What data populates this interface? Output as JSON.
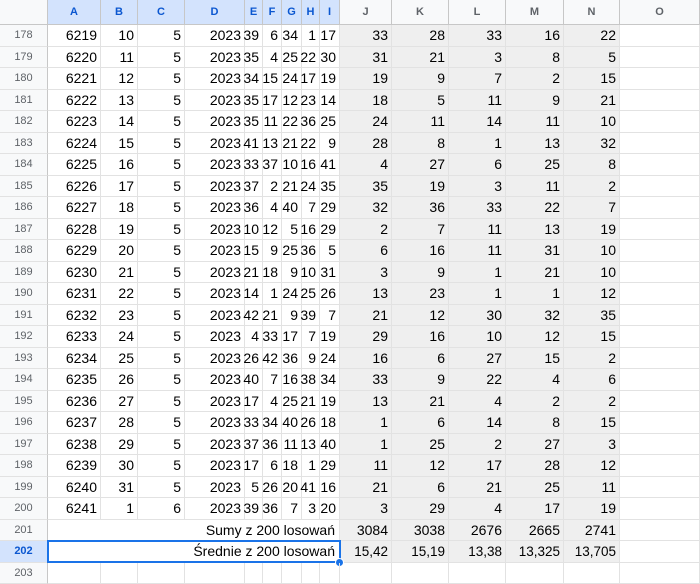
{
  "columns": [
    "A",
    "B",
    "C",
    "D",
    "E",
    "F",
    "G",
    "H",
    "I",
    "J",
    "K",
    "L",
    "M",
    "N",
    "O"
  ],
  "selected_row": "202",
  "rows": [
    {
      "num": "178",
      "cells": [
        "6219",
        "10",
        "5",
        "2023",
        "39",
        "6",
        "34",
        "1",
        "17",
        "33",
        "28",
        "33",
        "16",
        "22"
      ]
    },
    {
      "num": "179",
      "cells": [
        "6220",
        "11",
        "5",
        "2023",
        "35",
        "4",
        "25",
        "22",
        "30",
        "31",
        "21",
        "3",
        "8",
        "5"
      ]
    },
    {
      "num": "180",
      "cells": [
        "6221",
        "12",
        "5",
        "2023",
        "34",
        "15",
        "24",
        "17",
        "19",
        "19",
        "9",
        "7",
        "2",
        "15"
      ]
    },
    {
      "num": "181",
      "cells": [
        "6222",
        "13",
        "5",
        "2023",
        "35",
        "17",
        "12",
        "23",
        "14",
        "18",
        "5",
        "11",
        "9",
        "21"
      ]
    },
    {
      "num": "182",
      "cells": [
        "6223",
        "14",
        "5",
        "2023",
        "35",
        "11",
        "22",
        "36",
        "25",
        "24",
        "11",
        "14",
        "11",
        "10"
      ]
    },
    {
      "num": "183",
      "cells": [
        "6224",
        "15",
        "5",
        "2023",
        "41",
        "13",
        "21",
        "22",
        "9",
        "28",
        "8",
        "1",
        "13",
        "32"
      ]
    },
    {
      "num": "184",
      "cells": [
        "6225",
        "16",
        "5",
        "2023",
        "33",
        "37",
        "10",
        "16",
        "41",
        "4",
        "27",
        "6",
        "25",
        "8"
      ]
    },
    {
      "num": "185",
      "cells": [
        "6226",
        "17",
        "5",
        "2023",
        "37",
        "2",
        "21",
        "24",
        "35",
        "35",
        "19",
        "3",
        "11",
        "2"
      ]
    },
    {
      "num": "186",
      "cells": [
        "6227",
        "18",
        "5",
        "2023",
        "36",
        "4",
        "40",
        "7",
        "29",
        "32",
        "36",
        "33",
        "22",
        "7"
      ]
    },
    {
      "num": "187",
      "cells": [
        "6228",
        "19",
        "5",
        "2023",
        "10",
        "12",
        "5",
        "16",
        "29",
        "2",
        "7",
        "11",
        "13",
        "19"
      ]
    },
    {
      "num": "188",
      "cells": [
        "6229",
        "20",
        "5",
        "2023",
        "15",
        "9",
        "25",
        "36",
        "5",
        "6",
        "16",
        "11",
        "31",
        "10"
      ]
    },
    {
      "num": "189",
      "cells": [
        "6230",
        "21",
        "5",
        "2023",
        "21",
        "18",
        "9",
        "10",
        "31",
        "3",
        "9",
        "1",
        "21",
        "10"
      ]
    },
    {
      "num": "190",
      "cells": [
        "6231",
        "22",
        "5",
        "2023",
        "14",
        "1",
        "24",
        "25",
        "26",
        "13",
        "23",
        "1",
        "1",
        "12"
      ]
    },
    {
      "num": "191",
      "cells": [
        "6232",
        "23",
        "5",
        "2023",
        "42",
        "21",
        "9",
        "39",
        "7",
        "21",
        "12",
        "30",
        "32",
        "35"
      ]
    },
    {
      "num": "192",
      "cells": [
        "6233",
        "24",
        "5",
        "2023",
        "4",
        "33",
        "17",
        "7",
        "19",
        "29",
        "16",
        "10",
        "12",
        "15"
      ]
    },
    {
      "num": "193",
      "cells": [
        "6234",
        "25",
        "5",
        "2023",
        "26",
        "42",
        "36",
        "9",
        "24",
        "16",
        "6",
        "27",
        "15",
        "2"
      ]
    },
    {
      "num": "194",
      "cells": [
        "6235",
        "26",
        "5",
        "2023",
        "40",
        "7",
        "16",
        "38",
        "34",
        "33",
        "9",
        "22",
        "4",
        "6"
      ]
    },
    {
      "num": "195",
      "cells": [
        "6236",
        "27",
        "5",
        "2023",
        "17",
        "4",
        "25",
        "21",
        "19",
        "13",
        "21",
        "4",
        "2",
        "2"
      ]
    },
    {
      "num": "196",
      "cells": [
        "6237",
        "28",
        "5",
        "2023",
        "33",
        "34",
        "40",
        "26",
        "18",
        "1",
        "6",
        "14",
        "8",
        "15"
      ]
    },
    {
      "num": "197",
      "cells": [
        "6238",
        "29",
        "5",
        "2023",
        "37",
        "36",
        "11",
        "13",
        "40",
        "1",
        "25",
        "2",
        "27",
        "3"
      ]
    },
    {
      "num": "198",
      "cells": [
        "6239",
        "30",
        "5",
        "2023",
        "17",
        "6",
        "18",
        "1",
        "29",
        "11",
        "12",
        "17",
        "28",
        "12"
      ]
    },
    {
      "num": "199",
      "cells": [
        "6240",
        "31",
        "5",
        "2023",
        "5",
        "26",
        "20",
        "41",
        "16",
        "21",
        "6",
        "21",
        "25",
        "11"
      ]
    },
    {
      "num": "200",
      "cells": [
        "6241",
        "1",
        "6",
        "2023",
        "39",
        "36",
        "7",
        "3",
        "20",
        "3",
        "29",
        "4",
        "17",
        "19"
      ]
    }
  ],
  "sum_row": {
    "num": "201",
    "label": "Sumy z 200 losowań",
    "values": [
      "3084",
      "3038",
      "2676",
      "2665",
      "2741"
    ]
  },
  "avg_row": {
    "num": "202",
    "label": "Średnie  z 200 losowań",
    "values": [
      "15,42",
      "15,19",
      "13,38",
      "13,325",
      "13,705"
    ]
  },
  "empty_row": {
    "num": "203"
  },
  "colors": {
    "accent": "#1a73e8",
    "header_selected": "#d3e3fd",
    "gray_fill": "#efefef"
  }
}
